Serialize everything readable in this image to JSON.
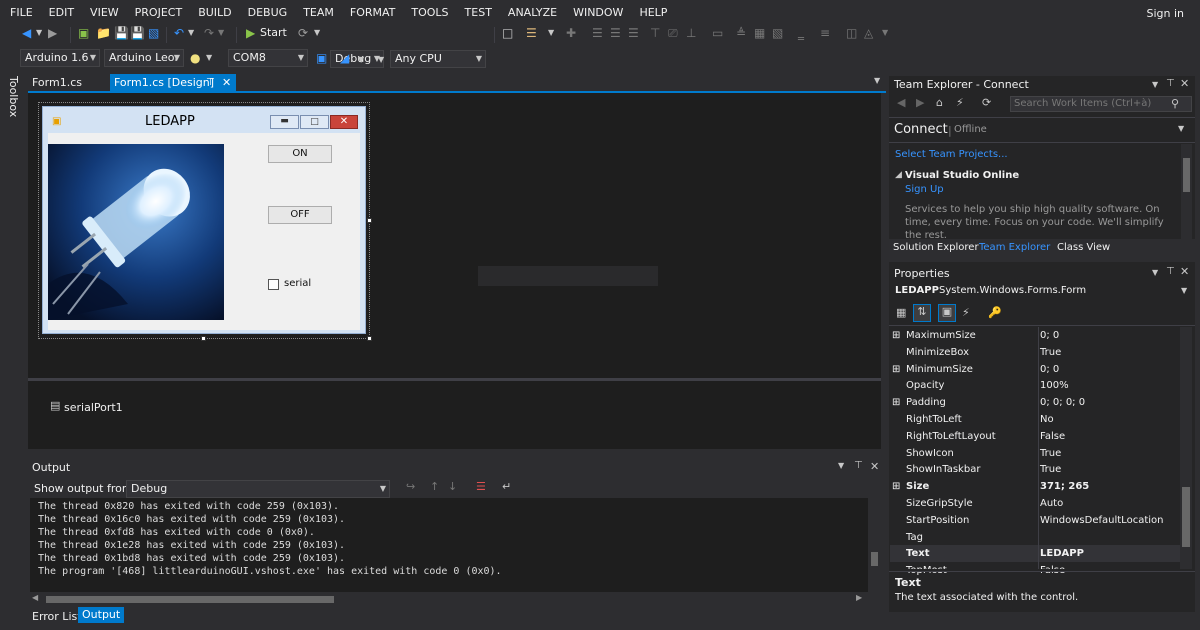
{
  "menu": {
    "items": [
      "FILE",
      "EDIT",
      "VIEW",
      "PROJECT",
      "BUILD",
      "DEBUG",
      "TEAM",
      "FORMAT",
      "TOOLS",
      "TEST",
      "ANALYZE",
      "WINDOW",
      "HELP"
    ],
    "signin": "Sign in"
  },
  "toolbar": {
    "start": "Start",
    "config": "Debug",
    "platform": "Any CPU",
    "board": "Arduino 1.6",
    "board2": "Arduino Leor",
    "port": "COM8"
  },
  "toolbox": {
    "label": "Toolbox"
  },
  "tabs": [
    {
      "label": "Form1.cs"
    },
    {
      "label": "Form1.cs [Design]"
    }
  ],
  "form": {
    "title": "LEDAPP",
    "on_label": "ON",
    "off_label": "OFF",
    "checkbox_label": "serial"
  },
  "tray": {
    "component": "serialPort1"
  },
  "output": {
    "title": "Output",
    "show_from_label": "Show output from:",
    "source": "Debug",
    "lines": [
      "The thread 0x820 has exited with code 259 (0x103).",
      "The thread 0x16c0 has exited with code 259 (0x103).",
      "The thread 0xfd8 has exited with code 0 (0x0).",
      "The thread 0x1e28 has exited with code 259 (0x103).",
      "The thread 0x1bd8 has exited with code 259 (0x103).",
      "The program '[468] littlearduinoGUI.vshost.exe' has exited with code 0 (0x0)."
    ]
  },
  "bottom_tabs": {
    "error_list": "Error List",
    "output": "Output"
  },
  "team_explorer": {
    "title": "Team Explorer - Connect",
    "search_placeholder": "Search Work Items (Ctrl+à)",
    "connect": "Connect",
    "offline": "Offline",
    "select_projects": "Select Team Projects...",
    "vso_title": "Visual Studio Online",
    "sign_up": "Sign Up",
    "services_text": "Services to help you ship high quality software. On time, every time. Focus on your code. We'll simplify the rest.",
    "tabs": [
      "Solution Explorer",
      "Team Explorer",
      "Class View"
    ]
  },
  "properties": {
    "title": "Properties",
    "object_name": "LEDAPP",
    "object_type": "System.Windows.Forms.Form",
    "rows": [
      {
        "name": "MaximumSize",
        "value": "0; 0",
        "expandable": true
      },
      {
        "name": "MinimizeBox",
        "value": "True",
        "expandable": false
      },
      {
        "name": "MinimumSize",
        "value": "0; 0",
        "expandable": true
      },
      {
        "name": "Opacity",
        "value": "100%",
        "expandable": false
      },
      {
        "name": "Padding",
        "value": "0; 0; 0; 0",
        "expandable": true
      },
      {
        "name": "RightToLeft",
        "value": "No",
        "expandable": false
      },
      {
        "name": "RightToLeftLayout",
        "value": "False",
        "expandable": false
      },
      {
        "name": "ShowIcon",
        "value": "True",
        "expandable": false
      },
      {
        "name": "ShowInTaskbar",
        "value": "True",
        "expandable": false
      },
      {
        "name": "Size",
        "value": "371; 265",
        "expandable": true,
        "bold": true
      },
      {
        "name": "SizeGripStyle",
        "value": "Auto",
        "expandable": false
      },
      {
        "name": "StartPosition",
        "value": "WindowsDefaultLocation",
        "expandable": false
      },
      {
        "name": "Tag",
        "value": "",
        "expandable": false
      },
      {
        "name": "Text",
        "value": "LEDAPP",
        "expandable": false,
        "bold": true
      },
      {
        "name": "TopMost",
        "value": "False",
        "expandable": false
      }
    ],
    "desc_title": "Text",
    "desc_text": "The text associated with the control."
  },
  "colors": {
    "accent": "#007acc",
    "background": "#2d2d30",
    "editor": "#1e1e1e"
  }
}
